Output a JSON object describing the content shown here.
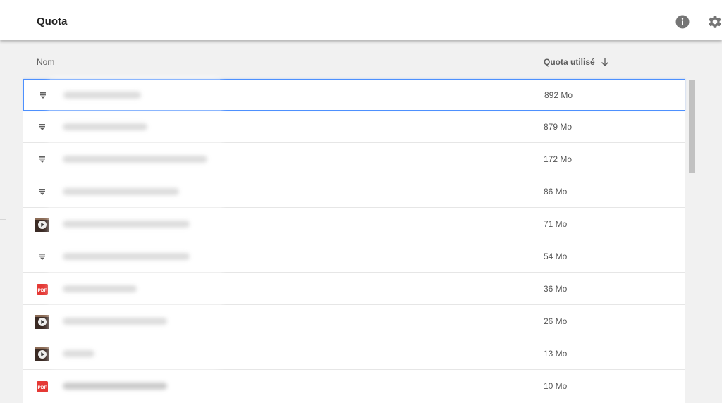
{
  "header": {
    "title": "Quota",
    "icons": {
      "info": "info-icon",
      "settings": "gear-icon"
    }
  },
  "table": {
    "columns": {
      "name": "Nom",
      "quota": "Quota utilisé"
    },
    "sort": "descending",
    "rows": [
      {
        "icon": "google-doc-icon",
        "size": "892 Mo",
        "selected": true
      },
      {
        "icon": "google-doc-icon",
        "size": "879 Mo"
      },
      {
        "icon": "google-doc-icon",
        "size": "172 Mo"
      },
      {
        "icon": "google-doc-icon",
        "size": "86 Mo"
      },
      {
        "icon": "video-thumbnail-icon",
        "size": "71 Mo"
      },
      {
        "icon": "google-doc-icon",
        "size": "54 Mo"
      },
      {
        "icon": "pdf-icon",
        "size": "36 Mo"
      },
      {
        "icon": "video-thumbnail-icon",
        "size": "26 Mo"
      },
      {
        "icon": "video-thumbnail-icon",
        "size": "13 Mo"
      },
      {
        "icon": "pdf-icon",
        "size": "10 Mo"
      }
    ]
  },
  "colors": {
    "selection_border": "#4d90fe",
    "pdf_red": "#e53935",
    "background": "#f1f1f1"
  }
}
